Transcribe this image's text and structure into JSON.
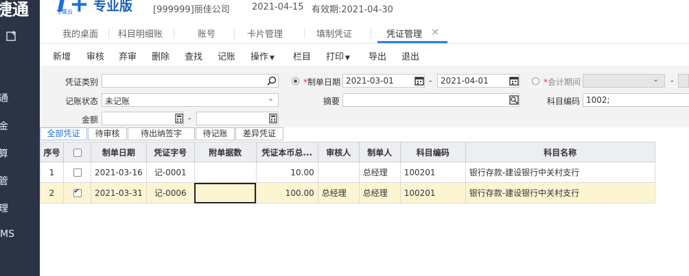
{
  "header": {
    "logo_text": "捷通",
    "brand_mark": "T+",
    "brand_sub": "专属云",
    "brand_name": "专业版",
    "company": "[999999]丽佳公司",
    "date": "2021-04-15",
    "validity": "有效期:2021-04-30"
  },
  "leftnav": {
    "items": [
      "通",
      "金",
      "算",
      "管",
      "理",
      "MS"
    ]
  },
  "tabs": [
    "我的桌面",
    "科目明细账",
    "账号",
    "卡片管理",
    "填制凭证",
    "凭证管理"
  ],
  "toolbar": {
    "add": "新增",
    "audit": "审核",
    "unaudit": "弃审",
    "delete": "删除",
    "find": "查找",
    "post": "记账",
    "operate": "操作",
    "columns": "栏目",
    "print": "打印",
    "export": "导出",
    "exit": "退出"
  },
  "filters": {
    "voucher_type_label": "凭证类别",
    "voucher_type_value": "",
    "post_status_label": "记账状态",
    "post_status_value": "未记账",
    "amount_label": "金额",
    "amount_from": "",
    "amount_to": "",
    "date_label": "制单日期",
    "date_from": "2021-03-01",
    "date_to": "2021-04-01",
    "summary_label": "摘要",
    "summary_value": "",
    "period_label": "会计期间",
    "account_code_label": "科目编码",
    "account_code_value": "1002;",
    "required_mark": "*",
    "range_sep": "-"
  },
  "subtabs": [
    "全部凭证",
    "待审核",
    "待出纳签字",
    "待记账",
    "差异凭证"
  ],
  "grid": {
    "columns": [
      "序号",
      "",
      "制单日期",
      "凭证字号",
      "附单据数",
      "凭证本币总...",
      "审核人",
      "制单人",
      "科目编码",
      "科目名称"
    ],
    "rows": [
      {
        "seq": "1",
        "checked": false,
        "date": "2021-03-16",
        "no": "记-0001",
        "attachments": "",
        "amount": "10.00",
        "auditor": "",
        "maker": "总经理",
        "code": "100201",
        "name": "银行存款-建设银行中关村支行"
      },
      {
        "seq": "2",
        "checked": true,
        "date": "2021-03-31",
        "no": "记-0006",
        "attachments": "",
        "amount": "100.00",
        "auditor": "总经理",
        "maker": "总经理",
        "code": "100201",
        "name": "银行存款-建设银行中关村支行"
      }
    ]
  },
  "colors": {
    "nav_bg": "#2b3445",
    "accent": "#2f7de1",
    "selected_row": "#fdf4d2"
  }
}
